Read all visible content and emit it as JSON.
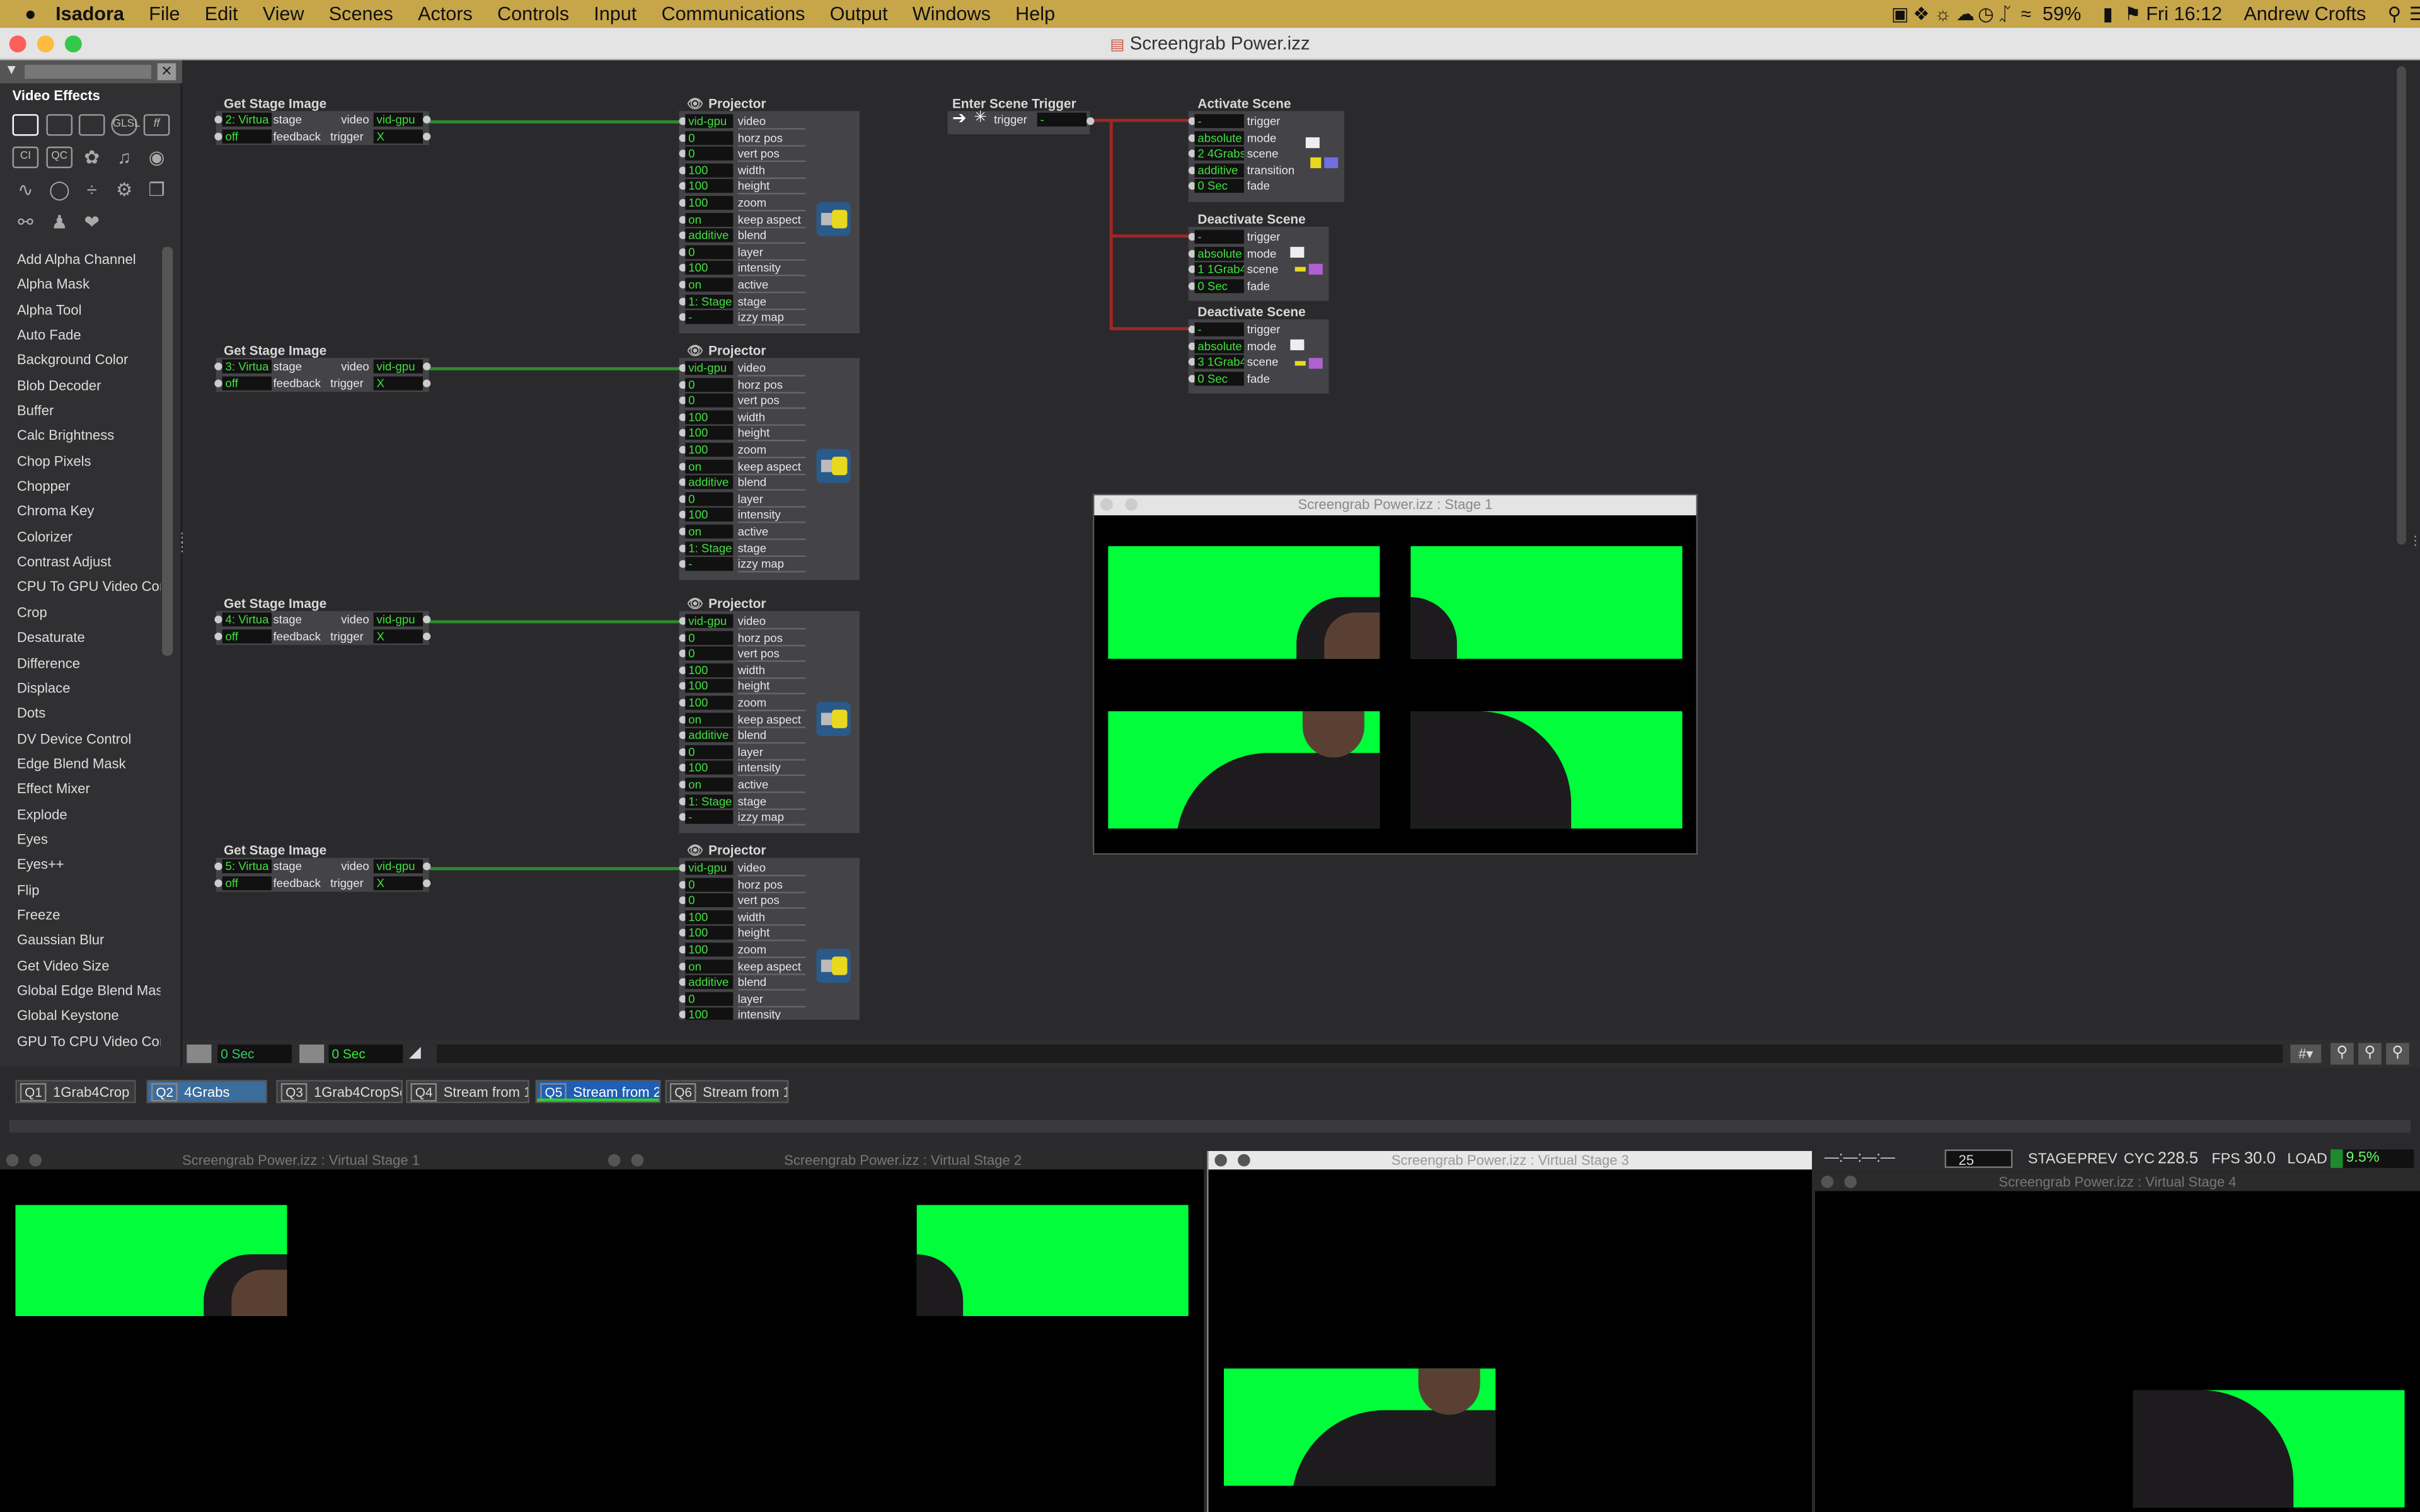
{
  "menubar": {
    "apple": "",
    "app": "Isadora",
    "items": [
      "File",
      "Edit",
      "View",
      "Scenes",
      "Actors",
      "Controls",
      "Input",
      "Communications",
      "Output",
      "Windows",
      "Help"
    ],
    "battery": "59%",
    "datetime": "Fri 16:12",
    "user": "Andrew Crofts"
  },
  "window": {
    "title": "Screengrab Power.izz"
  },
  "panel": {
    "title": "Video Effects",
    "items": [
      "Add Alpha Channel",
      "Alpha Mask",
      "Alpha Tool",
      "Auto Fade",
      "Background Color",
      "Blob Decoder",
      "Buffer",
      "Calc Brightness",
      "Chop Pixels",
      "Chopper",
      "Chroma Key",
      "Colorizer",
      "Contrast Adjust",
      "CPU To GPU Video Cor",
      "Crop",
      "Desaturate",
      "Difference",
      "Displace",
      "Dots",
      "DV Device Control",
      "Edge Blend Mask",
      "Effect Mixer",
      "Explode",
      "Eyes",
      "Eyes++",
      "Flip",
      "Freeze",
      "Gaussian Blur",
      "Get Video Size",
      "Global Edge Blend Mas",
      "Global Keystone",
      "GPU To CPU Video Cor"
    ],
    "tool_labels": {
      "ci": "CI",
      "qc": "QC",
      "ff": "ff",
      "gl": "GLSL"
    }
  },
  "get_stage_actors": [
    {
      "title": "Get Stage Image",
      "stage_val": "2: Virtua",
      "feedback_val": "off",
      "out_val": "vid-gpu",
      "trigger_val": "X"
    },
    {
      "title": "Get Stage Image",
      "stage_val": "3: Virtua",
      "feedback_val": "off",
      "out_val": "vid-gpu",
      "trigger_val": "X"
    },
    {
      "title": "Get Stage Image",
      "stage_val": "4: Virtua",
      "feedback_val": "off",
      "out_val": "vid-gpu",
      "trigger_val": "X"
    },
    {
      "title": "Get Stage Image",
      "stage_val": "5: Virtua",
      "feedback_val": "off",
      "out_val": "vid-gpu",
      "trigger_val": "X"
    }
  ],
  "get_stage_labels": {
    "stage": "stage",
    "feedback": "feedback",
    "video": "video",
    "trigger": "trigger"
  },
  "projector_actors": [
    {
      "title": "Projector",
      "rows": [
        [
          "vid-gpu",
          "video"
        ],
        [
          "0",
          "horz pos"
        ],
        [
          "0",
          "vert pos"
        ],
        [
          "100",
          "width"
        ],
        [
          "100",
          "height"
        ],
        [
          "100",
          "zoom"
        ],
        [
          "on",
          "keep aspect"
        ],
        [
          "additive",
          "blend"
        ],
        [
          "0",
          "layer"
        ],
        [
          "100",
          "intensity"
        ],
        [
          "on",
          "active"
        ],
        [
          "1: Stage",
          "stage"
        ],
        [
          "-",
          "izzy map"
        ]
      ]
    },
    {
      "title": "Projector",
      "rows": [
        [
          "vid-gpu",
          "video"
        ],
        [
          "0",
          "horz pos"
        ],
        [
          "0",
          "vert pos"
        ],
        [
          "100",
          "width"
        ],
        [
          "100",
          "height"
        ],
        [
          "100",
          "zoom"
        ],
        [
          "on",
          "keep aspect"
        ],
        [
          "additive",
          "blend"
        ],
        [
          "0",
          "layer"
        ],
        [
          "100",
          "intensity"
        ],
        [
          "on",
          "active"
        ],
        [
          "1: Stage",
          "stage"
        ],
        [
          "-",
          "izzy map"
        ]
      ]
    },
    {
      "title": "Projector",
      "rows": [
        [
          "vid-gpu",
          "video"
        ],
        [
          "0",
          "horz pos"
        ],
        [
          "0",
          "vert pos"
        ],
        [
          "100",
          "width"
        ],
        [
          "100",
          "height"
        ],
        [
          "100",
          "zoom"
        ],
        [
          "on",
          "keep aspect"
        ],
        [
          "additive",
          "blend"
        ],
        [
          "0",
          "layer"
        ],
        [
          "100",
          "intensity"
        ],
        [
          "on",
          "active"
        ],
        [
          "1: Stage",
          "stage"
        ],
        [
          "-",
          "izzy map"
        ]
      ]
    },
    {
      "title": "Projector",
      "rows": [
        [
          "vid-gpu",
          "video"
        ],
        [
          "0",
          "horz pos"
        ],
        [
          "0",
          "vert pos"
        ],
        [
          "100",
          "width"
        ],
        [
          "100",
          "height"
        ],
        [
          "100",
          "zoom"
        ],
        [
          "on",
          "keep aspect"
        ],
        [
          "additive",
          "blend"
        ],
        [
          "0",
          "layer"
        ],
        [
          "100",
          "intensity"
        ]
      ]
    }
  ],
  "enter_scene": {
    "title": "Enter Scene Trigger",
    "label": "trigger",
    "val": "-"
  },
  "activate_scene": {
    "title": "Activate Scene",
    "rows": [
      [
        "-",
        "trigger"
      ],
      [
        "absolute",
        "mode"
      ],
      [
        "2 4Grabs",
        "scene"
      ],
      [
        "additive",
        "transition"
      ],
      [
        "0 Sec",
        "fade"
      ]
    ]
  },
  "deactivate_scenes": [
    {
      "title": "Deactivate Scene",
      "rows": [
        [
          "-",
          "trigger"
        ],
        [
          "absolute",
          "mode"
        ],
        [
          "1 1Grab4",
          "scene"
        ],
        [
          "0 Sec",
          "fade"
        ]
      ]
    },
    {
      "title": "Deactivate Scene",
      "rows": [
        [
          "-",
          "trigger"
        ],
        [
          "absolute",
          "mode"
        ],
        [
          "3 1Grab4",
          "scene"
        ],
        [
          "0 Sec",
          "fade"
        ]
      ]
    }
  ],
  "stage_window": {
    "title": "Screengrab Power.izz : Stage 1"
  },
  "timebar": {
    "left_time": "0 Sec",
    "right_time": "0 Sec",
    "hash": "#"
  },
  "scenes": [
    {
      "q": "Q1",
      "name": "1Grab4Crop",
      "active": false
    },
    {
      "q": "Q2",
      "name": "4Grabs",
      "active": true
    },
    {
      "q": "Q3",
      "name": "1Grab4CropSc",
      "active": false
    },
    {
      "q": "Q4",
      "name": "Stream from 1",
      "active": false
    },
    {
      "q": "Q5",
      "name": "Stream from 2",
      "active": true
    },
    {
      "q": "Q6",
      "name": "Stream from 1",
      "active": false
    }
  ],
  "virtual_stages": [
    {
      "title": "Screengrab Power.izz : Virtual Stage 1"
    },
    {
      "title": "Screengrab Power.izz : Virtual Stage 2"
    },
    {
      "title": "Screengrab Power.izz : Virtual Stage 3"
    },
    {
      "title": "Screengrab Power.izz : Virtual Stage 4"
    }
  ],
  "status": {
    "timecode": "—:—:—:—",
    "rate": "25",
    "stage": "STAGE",
    "prev": "PREV",
    "cyc_label": "CYC",
    "cyc": "228.5",
    "fps_label": "FPS",
    "fps": "30.0",
    "load_label": "LOAD",
    "load": "9.5%"
  },
  "colors": {
    "menubar": "#c7a64a",
    "green_screen": "#00ff3a",
    "value_text": "#3fe03f",
    "cable_red": "#a02626",
    "cable_green": "#2e8b2e"
  }
}
